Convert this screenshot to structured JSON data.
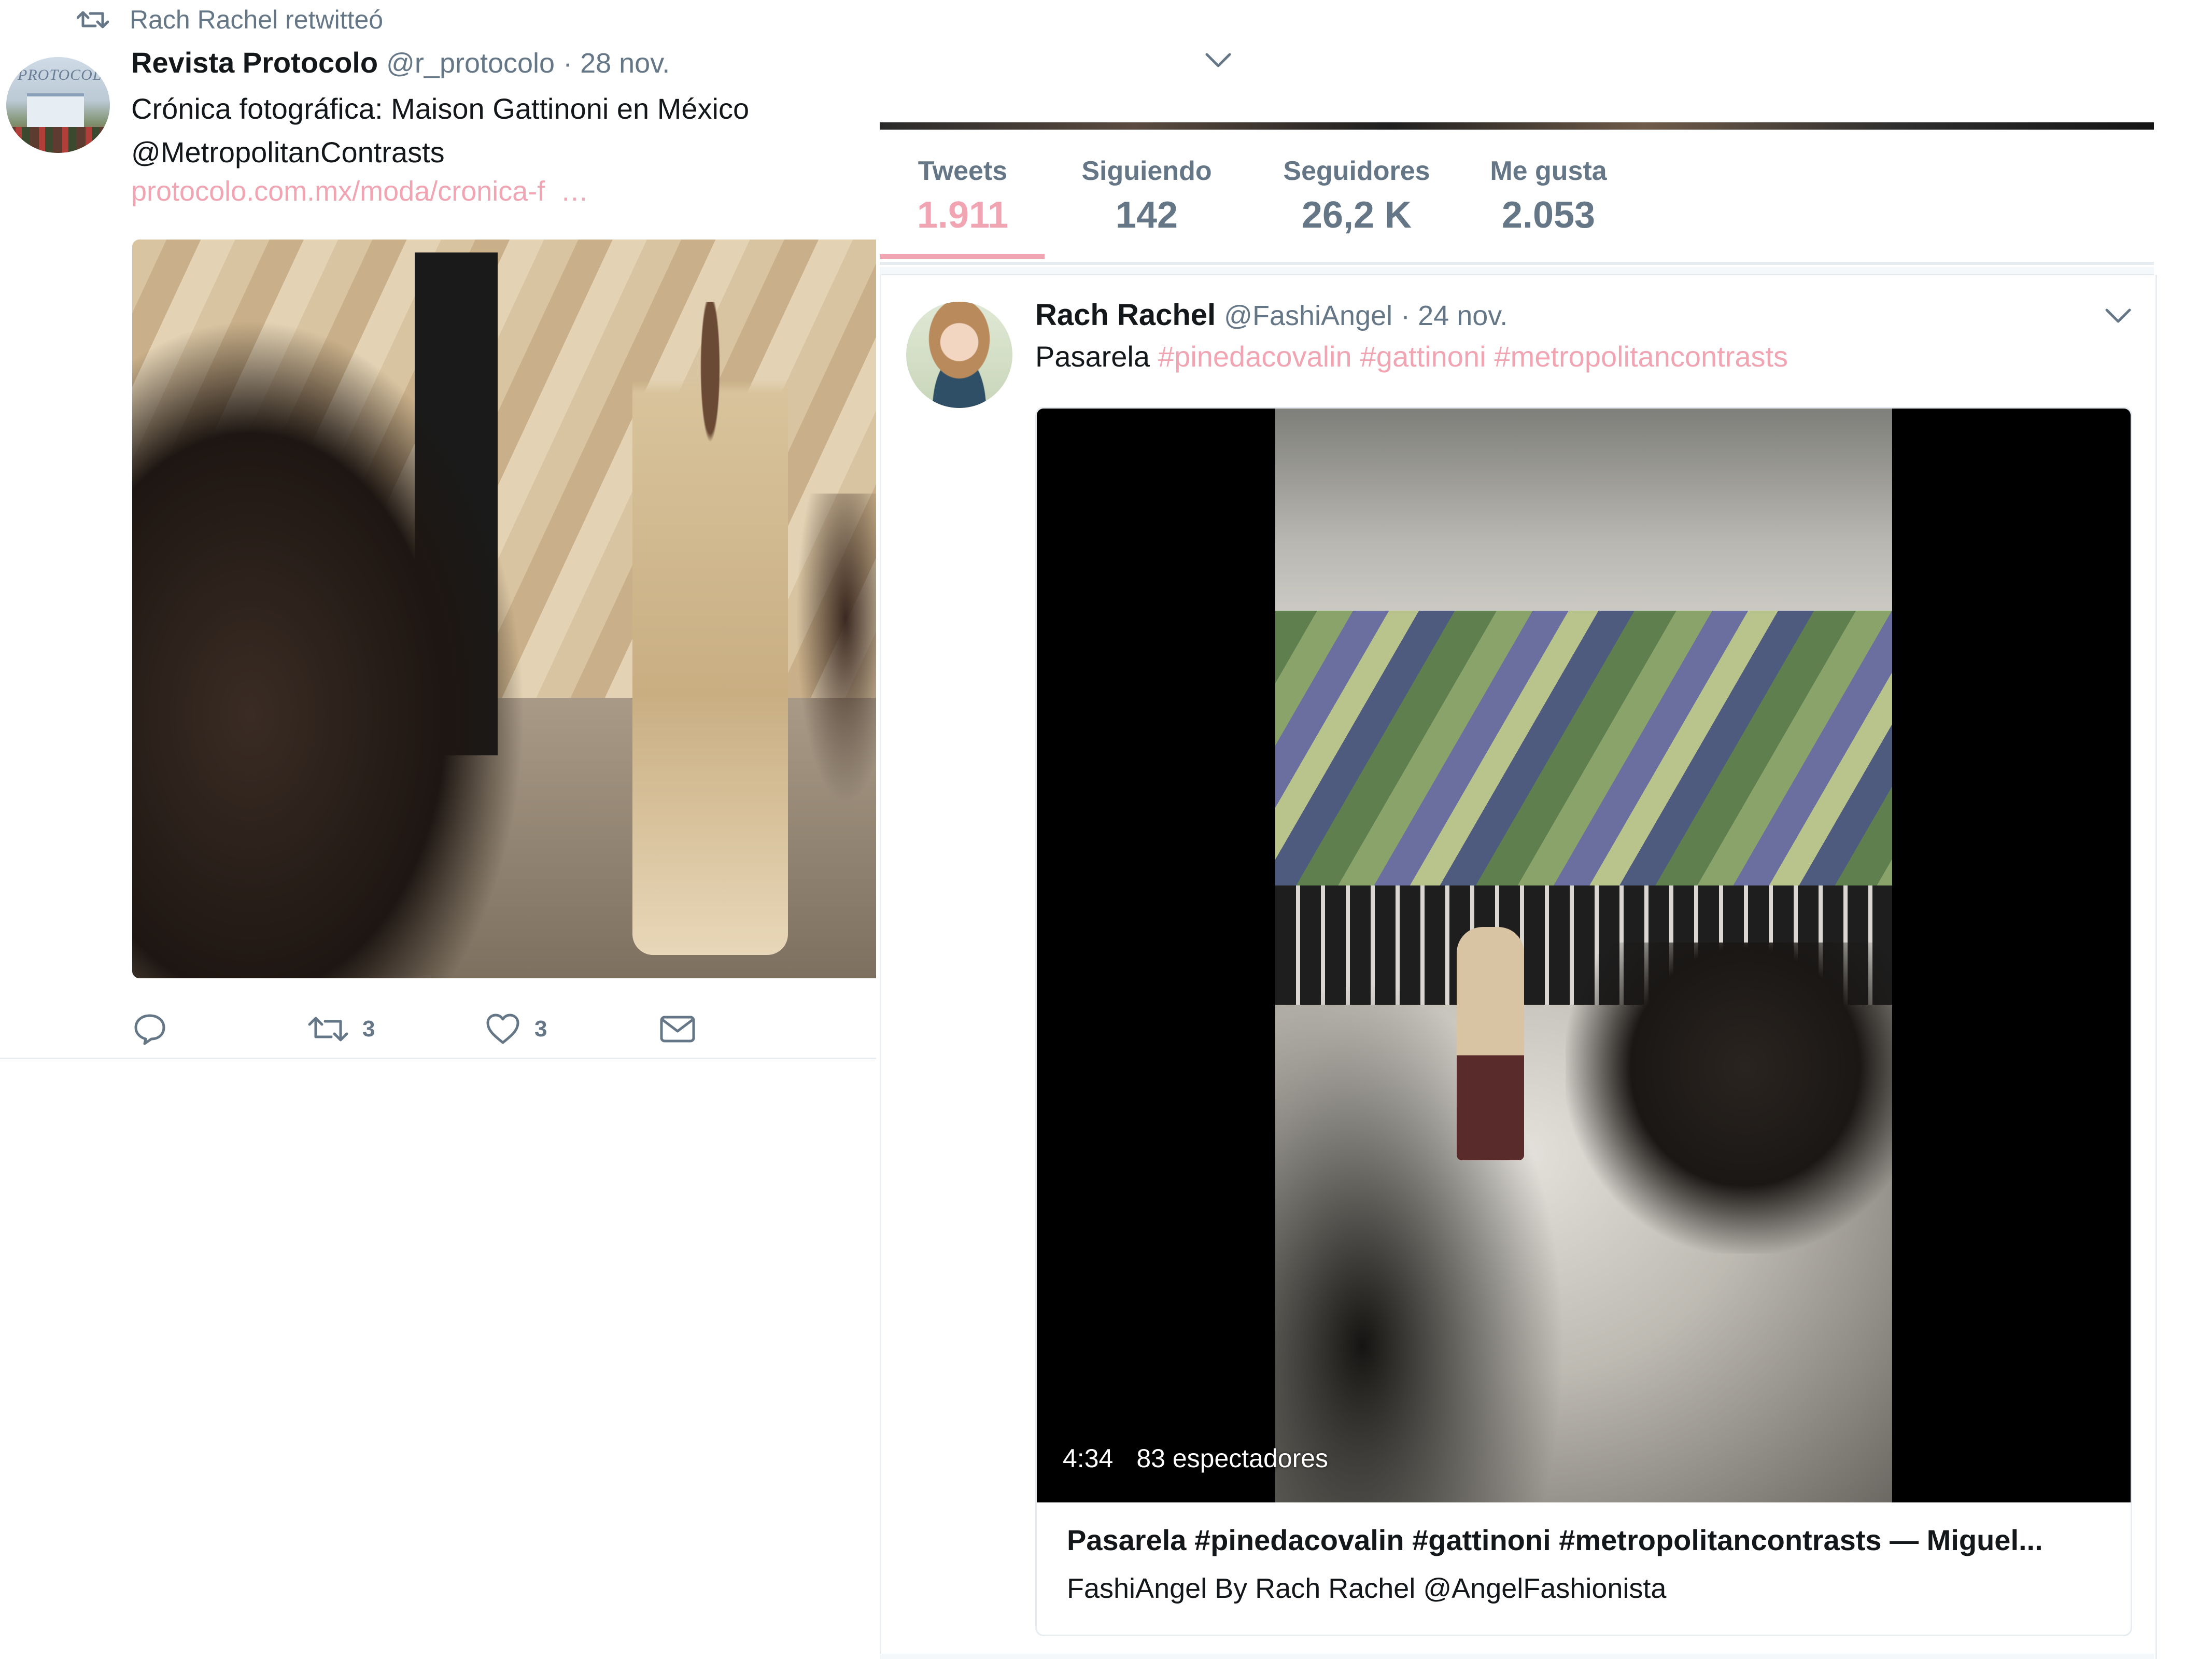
{
  "left_tweet": {
    "retweet_context": "Rach Rachel retwitteó",
    "author_name": "Revista Protocolo",
    "author_handle": "@r_protocolo",
    "date": "· 28 nov.",
    "text_line1": "Crónica fotográfica: Maison Gattinoni en México",
    "text_line2": "@MetropolitanContrasts",
    "link": "protocolo.com.mx/moda/cronica-f",
    "link_ellipsis": "…",
    "avatar_sign": "PROTOCOLO",
    "actions": {
      "retweets": "3",
      "likes": "3"
    }
  },
  "profile": {
    "stats": [
      {
        "label": "Tweets",
        "value": "1.911"
      },
      {
        "label": "Siguiendo",
        "value": "142"
      },
      {
        "label": "Seguidores",
        "value": "26,2 K"
      },
      {
        "label": "Me gusta",
        "value": "2.053"
      }
    ]
  },
  "right_tweet": {
    "author_name": "Rach Rachel",
    "author_handle": "@FashiAngel",
    "date": "· 24 nov.",
    "text": "Pasarela",
    "hashtags": [
      "#pinedacovalin",
      "#gattinoni",
      "#metropolitancontrasts"
    ],
    "video": {
      "duration": "4:34",
      "views": "83 espectadores"
    },
    "card": {
      "title": "Pasarela #pinedacovalin #gattinoni #metropolitancontrasts — Miguel...",
      "subtitle": "FashiAngel By Rach Rachel @AngelFashionista"
    }
  },
  "colors": {
    "accent": "#f1a5b3",
    "muted": "#657786",
    "text": "#14171a",
    "border": "#e6ecf0"
  },
  "icons": [
    "retweet-icon",
    "reply-icon",
    "heart-icon",
    "mail-icon",
    "chevron-down-icon"
  ]
}
